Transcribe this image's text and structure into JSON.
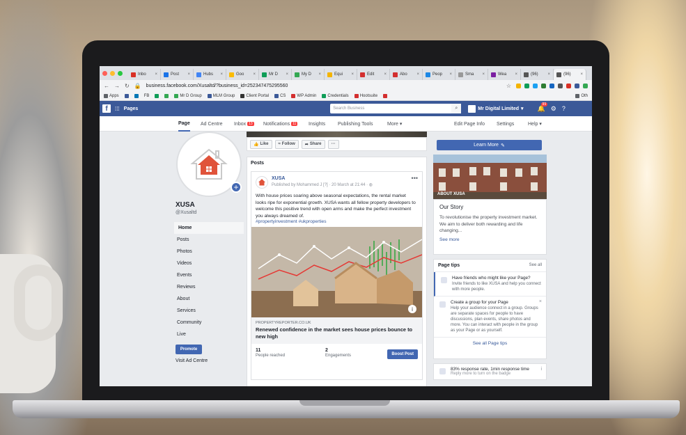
{
  "browser": {
    "tabs": [
      {
        "label": "Inbo",
        "color": "#d93025"
      },
      {
        "label": "Post",
        "color": "#1a73e8"
      },
      {
        "label": "Hubs",
        "color": "#4285f4"
      },
      {
        "label": "Goo",
        "color": "#fbbc04"
      },
      {
        "label": "Mr D",
        "color": "#0f9d58"
      },
      {
        "label": "My D",
        "color": "#34a853"
      },
      {
        "label": "Equi",
        "color": "#f4b400"
      },
      {
        "label": "Edit",
        "color": "#d32f2f"
      },
      {
        "label": "Abo",
        "color": "#d32f2f"
      },
      {
        "label": "Peop",
        "color": "#1e88e5"
      },
      {
        "label": "Sma",
        "color": "#999999"
      },
      {
        "label": "Wea",
        "color": "#7b1fa2"
      },
      {
        "label": "(96)",
        "color": "#555555"
      },
      {
        "label": "(96)",
        "color": "#555555"
      }
    ],
    "url": "business.facebook.com/Xusaltd/?business_id=252347475295560",
    "bookmarks": [
      "Apps",
      "FB",
      "Mr D Group",
      "MLM Group",
      "Client Portal",
      "CS",
      "WP Admin",
      "Credentials",
      "Hootsuite",
      "Oth"
    ]
  },
  "fb_header": {
    "pages_label": "Pages",
    "search_placeholder": "Search Business",
    "account_name": "Mr Digital Limited",
    "notif_count": "99"
  },
  "page_nav": {
    "items": [
      {
        "label": "Page"
      },
      {
        "label": "Ad Centre"
      },
      {
        "label": "Inbox",
        "badge": "13"
      },
      {
        "label": "Notifications",
        "badge": "11"
      },
      {
        "label": "Insights"
      },
      {
        "label": "Publishing Tools"
      },
      {
        "label": "More ▾"
      },
      {
        "label": "Edit Page Info"
      },
      {
        "label": "Settings"
      },
      {
        "label": "Help ▾"
      }
    ]
  },
  "profile": {
    "name": "XUSA",
    "handle": "@Xusaltd",
    "nav": [
      "Home",
      "Posts",
      "Photos",
      "Videos",
      "Events",
      "Reviews",
      "About",
      "Services",
      "Community",
      "Live"
    ],
    "promote_label": "Promote",
    "visit_ad_label": "Visit Ad Centre"
  },
  "actions": {
    "like": "Like",
    "follow": "Follow",
    "share": "Share",
    "more": "···"
  },
  "posts": {
    "heading": "Posts",
    "author": "XUSA",
    "meta": "Published by Mohammed J [?] · 20 March at 21:44 ·",
    "text": "With house prices soaring above seasonal expectations, the rental market looks ripe for exponential growth. XUSA wants all fellow property developers to welcome this positive trend with open arms and make the perfect investment you always dreamed of.",
    "hashtags": "#propertyinvestment #ukproperties",
    "link_source": "PROPERTYREPORTER.CO.UK",
    "link_title": "Renewed confidence in the market sees house prices bounce to new high",
    "reached_count": "11",
    "reached_label": "People reached",
    "engagements_count": "2",
    "engagements_label": "Engagements",
    "boost_label": "Boost Post"
  },
  "sidebar_right": {
    "learn_more": "Learn More",
    "about_label": "ABOUT XUSA",
    "story_heading": "Our Story",
    "story_text": "To revolutionise the property investment market. We aim to deliver both rewarding and life changing...",
    "see_more": "See more",
    "tips_heading": "Page tips",
    "tips_see_all": "See all",
    "tip1_title": "Have friends who might like your Page?",
    "tip1_desc": "Invite friends to like XUSA and help you connect with more people.",
    "tip2_title": "Create a group for your Page",
    "tip2_desc": "Help your audience connect in a group. Groups are separate spaces for people to have discussions, plan events, share photos and more. You can interact with people in the group as your Page or as yourself.",
    "see_all_tips": "See all Page tips",
    "response_title": "83% response rate, 1min response time",
    "response_desc": "Reply more to turn on the badge"
  },
  "colors": {
    "fb_blue": "#3b5998",
    "button_blue": "#4267b2",
    "link_blue": "#365899",
    "house_red": "#e0533a"
  }
}
